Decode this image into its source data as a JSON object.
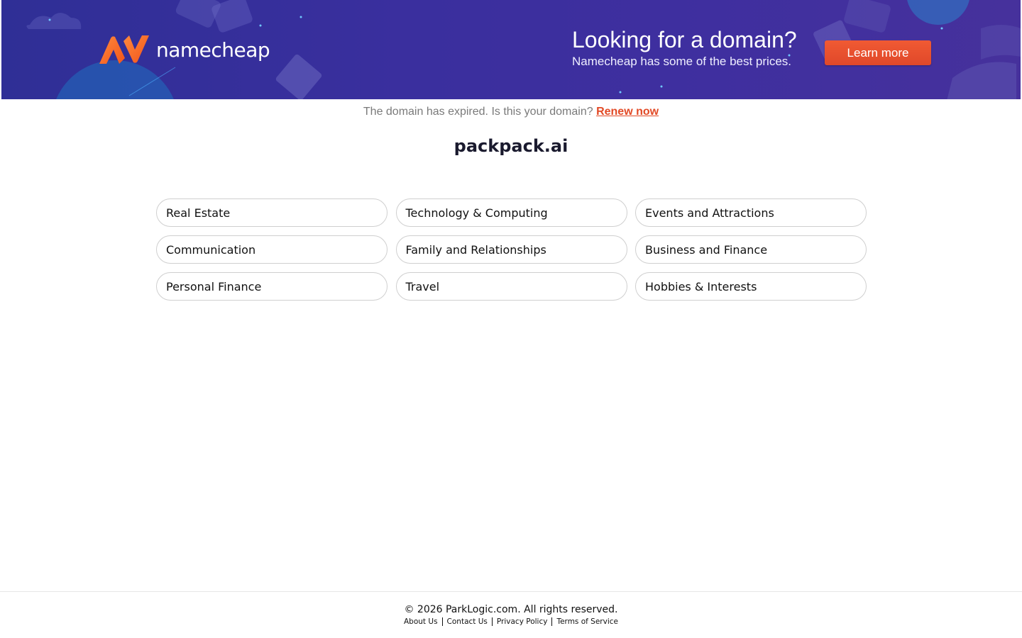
{
  "banner": {
    "logo_text": "namecheap",
    "title": "Looking for a domain?",
    "subtitle": "Namecheap has some of the best prices.",
    "cta_label": "Learn more",
    "colors": {
      "background": "#3a2f9e",
      "accent": "#f26522",
      "button": "#e8502e"
    }
  },
  "notice": {
    "text": "The domain has expired. Is this your domain?",
    "link_label": "Renew now",
    "link_color": "#e24a26"
  },
  "domain": "packpack.ai",
  "categories": [
    "Real Estate",
    "Technology & Computing",
    "Events and Attractions",
    "Communication",
    "Family and Relationships",
    "Business and Finance",
    "Personal Finance",
    "Travel",
    "Hobbies & Interests"
  ],
  "footer": {
    "copyright": "© 2026 ParkLogic.com. All rights reserved.",
    "links": [
      "About Us",
      "Contact Us",
      "Privacy Policy",
      "Terms of Service"
    ]
  }
}
